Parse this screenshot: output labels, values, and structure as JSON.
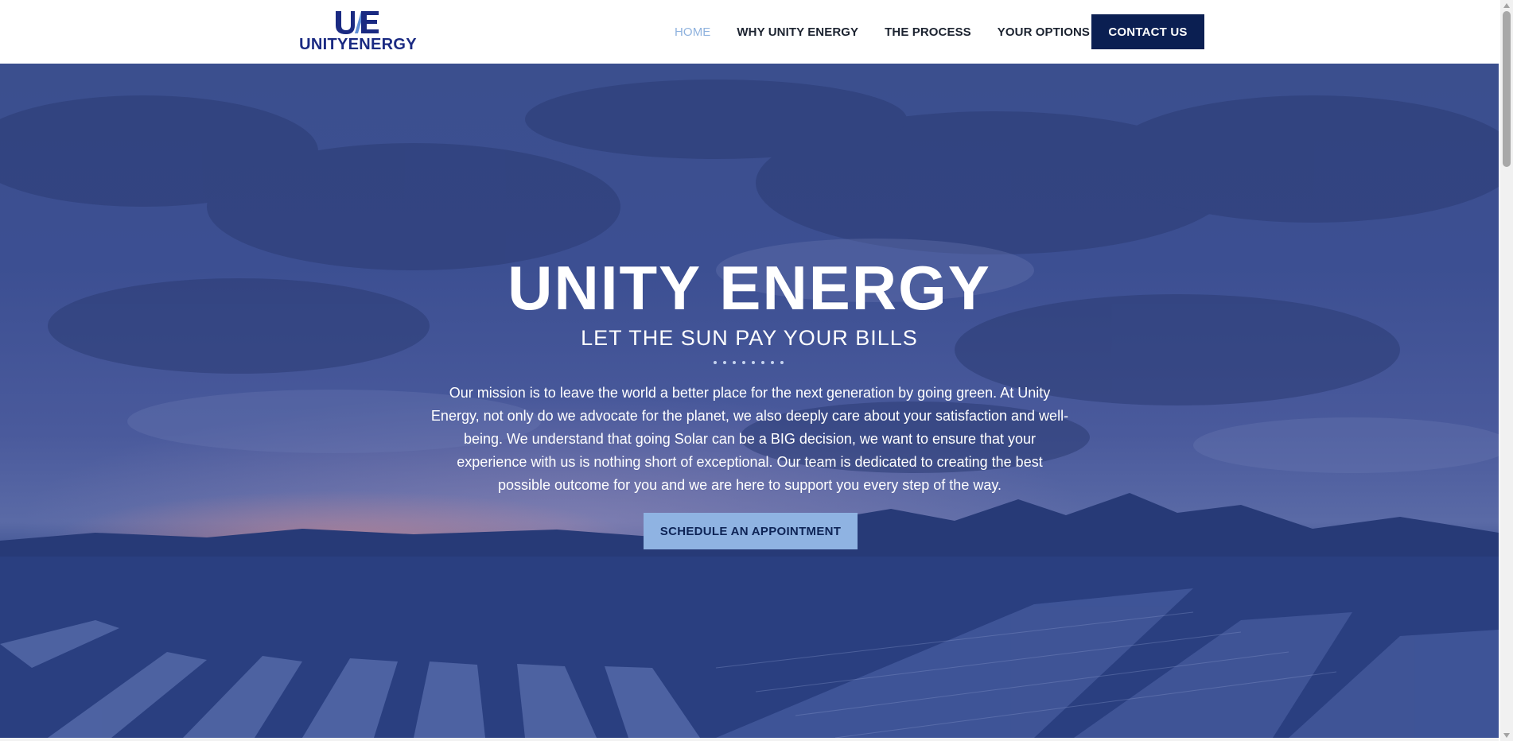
{
  "header": {
    "logo": {
      "monogram": "U/E",
      "wordmark": "UNITYENERGY",
      "brand_color": "#1a2a82"
    },
    "nav": {
      "items": [
        {
          "label": "HOME",
          "active": true
        },
        {
          "label": "WHY UNITY ENERGY",
          "active": false
        },
        {
          "label": "THE PROCESS",
          "active": false
        },
        {
          "label": "YOUR OPTIONS",
          "active": false
        }
      ],
      "active_color": "#8fb2de"
    },
    "contact_button": {
      "label": "CONTACT US",
      "color": "#0b1f52"
    }
  },
  "hero": {
    "title": "UNITY ENERGY",
    "subtitle": "LET THE SUN PAY YOUR BILLS",
    "mission": "Our mission is to leave the world a better place for the next generation by going green. At Unity Energy, not only do we advocate for the planet, we also deeply care about your satisfaction and well-being. We understand that going Solar can be a BIG decision, we want to ensure that your experience with us is nothing short of exceptional. Our team is dedicated to creating the best possible outcome for you and we are here to support you every step of the way.",
    "cta_button": {
      "label": "SCHEDULE AN APPOINTMENT",
      "color": "#8fb3e2"
    },
    "overlay_color": "#3b4f8e"
  }
}
